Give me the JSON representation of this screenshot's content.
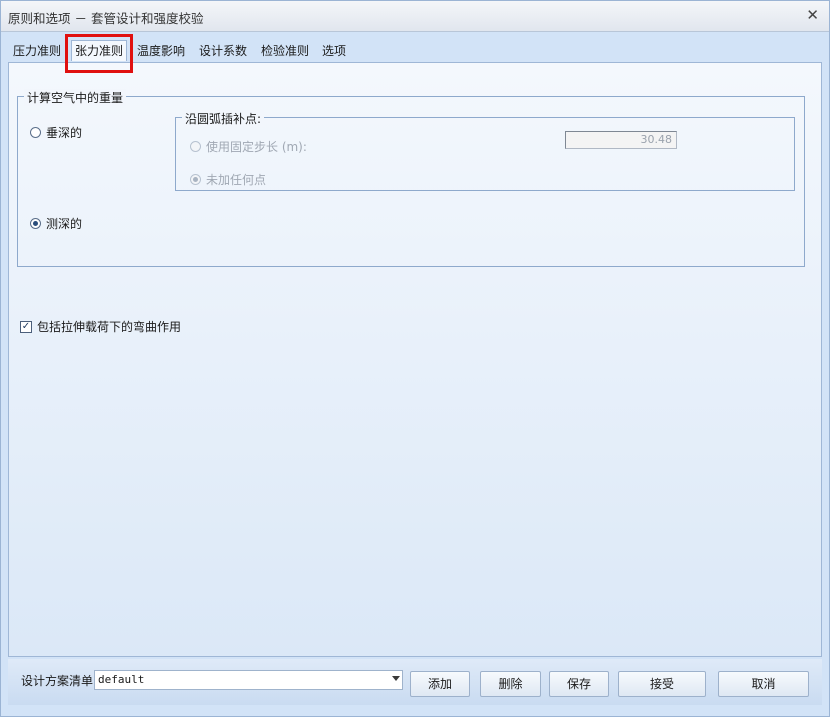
{
  "window": {
    "title": "原则和选项 － 套管设计和强度校验"
  },
  "tabs": [
    {
      "label": "压力准则"
    },
    {
      "label": "张力准则"
    },
    {
      "label": "温度影响"
    },
    {
      "label": "设计系数"
    },
    {
      "label": "检验准则"
    },
    {
      "label": "选项"
    }
  ],
  "weight_group": {
    "title": "计算空气中的重量",
    "tvd_label": "垂深的",
    "md_label": "测深的",
    "selected": "测深的"
  },
  "interp_group": {
    "title": "沿圆弧插补点:",
    "fixed_step_label": "使用固定步长 (m):",
    "fixed_step_value": "30.48",
    "none_label": "未加任何点"
  },
  "bending": {
    "label": "包括拉伸载荷下的弯曲作用",
    "checked": true
  },
  "footer": {
    "plan_label": "设计方案清单",
    "plan_value": "default",
    "add": "添加",
    "delete": "删除",
    "save": "保存",
    "accept": "接受",
    "cancel": "取消"
  },
  "colors": {
    "highlight": "#e01010",
    "window_bg": "#d2e3f7"
  }
}
